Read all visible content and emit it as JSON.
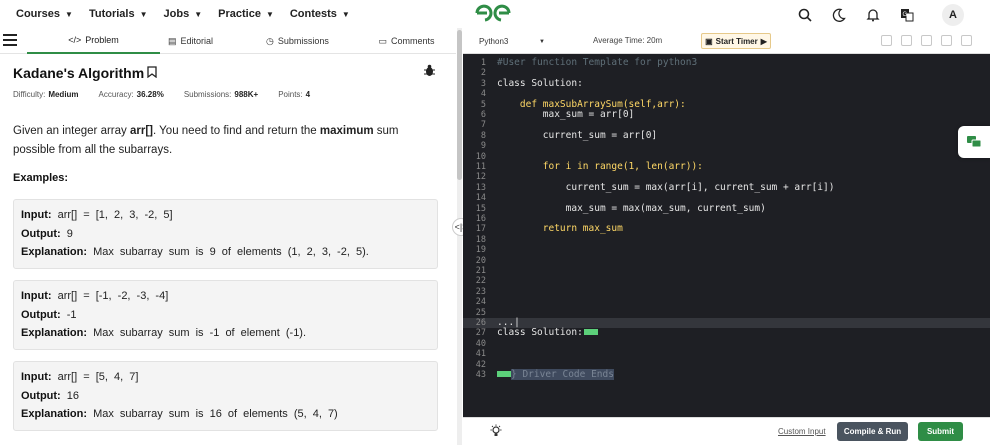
{
  "nav": {
    "items": [
      {
        "label": "Courses"
      },
      {
        "label": "Tutorials"
      },
      {
        "label": "Jobs"
      },
      {
        "label": "Practice"
      },
      {
        "label": "Contests"
      }
    ],
    "avatar_letter": "A",
    "icons": [
      "search-icon",
      "moon-icon",
      "bell-icon",
      "translate-icon"
    ]
  },
  "tabs": [
    {
      "label": "Problem",
      "icon": "code-icon",
      "active": true
    },
    {
      "label": "Editorial",
      "icon": "document-icon",
      "active": false
    },
    {
      "label": "Submissions",
      "icon": "clock-icon",
      "active": false
    },
    {
      "label": "Comments",
      "icon": "comment-icon",
      "active": false
    }
  ],
  "problem": {
    "title": "Kadane's Algorithm",
    "difficulty_label": "Difficulty:",
    "difficulty": "Medium",
    "accuracy_label": "Accuracy:",
    "accuracy": "36.28%",
    "submissions_label": "Submissions:",
    "submissions": "988K+",
    "points_label": "Points:",
    "points": "4",
    "desc_1": "Given an integer array ",
    "desc_arr": "arr[]",
    "desc_2": ". You need to find and return the ",
    "desc_max": "maximum",
    "desc_3": " sum possible from all the subarrays.",
    "examples_title": "Examples:",
    "examples": [
      {
        "input": "arr[] = [1, 2, 3, -2, 5]",
        "output": "9",
        "explanation": "Max subarray sum is 9 of elements (1, 2, 3, -2, 5)."
      },
      {
        "input": "arr[] = [-1, -2, -3, -4]",
        "output": "-1",
        "explanation": "Max subarray sum is -1 of element (-1)."
      },
      {
        "input": "arr[] = [5, 4, 7]",
        "output": "16",
        "explanation": "Max subarray sum is 16 of elements (5, 4, 7)"
      }
    ],
    "input_label": "Input:",
    "output_label": "Output:",
    "explanation_label": "Explanation:"
  },
  "editor": {
    "language": "Python3",
    "avg_time": "Average Time: 20m",
    "timer_label": "Start Timer",
    "custom_input": "Custom Input",
    "run_label": "Compile & Run",
    "submit_label": "Submit",
    "lines": [
      {
        "n": "1",
        "text": "#User function Template for python3"
      },
      {
        "n": "2",
        "text": ""
      },
      {
        "n": "3",
        "text": "class Solution:"
      },
      {
        "n": "4",
        "text": ""
      },
      {
        "n": "5",
        "text": "    def maxSubArraySum(self,arr):"
      },
      {
        "n": "6",
        "text": "        max_sum = arr[0]"
      },
      {
        "n": "7",
        "text": ""
      },
      {
        "n": "8",
        "text": "        current_sum = arr[0]"
      },
      {
        "n": "9",
        "text": ""
      },
      {
        "n": "10",
        "text": ""
      },
      {
        "n": "11",
        "text": "        for i in range(1, len(arr)):"
      },
      {
        "n": "12",
        "text": ""
      },
      {
        "n": "13",
        "text": "            current_sum = max(arr[i], current_sum + arr[i])"
      },
      {
        "n": "14",
        "text": ""
      },
      {
        "n": "15",
        "text": "            max_sum = max(max_sum, current_sum)"
      },
      {
        "n": "16",
        "text": ""
      },
      {
        "n": "17",
        "text": "        return max_sum"
      },
      {
        "n": "18",
        "text": ""
      },
      {
        "n": "19",
        "text": ""
      },
      {
        "n": "20",
        "text": ""
      },
      {
        "n": "21",
        "text": ""
      },
      {
        "n": "22",
        "text": ""
      },
      {
        "n": "23",
        "text": ""
      },
      {
        "n": "24",
        "text": ""
      },
      {
        "n": "25",
        "text": ""
      },
      {
        "n": "26",
        "text": "...|"
      },
      {
        "n": "27",
        "text": "class Solution:"
      },
      {
        "n": "40",
        "text": ""
      },
      {
        "n": "41",
        "text": ""
      },
      {
        "n": "42",
        "text": ""
      },
      {
        "n": "43",
        "text": "} Driver Code Ends"
      }
    ]
  },
  "colors": {
    "brand_green": "#2f8d46",
    "editor_bg": "#1e1f24"
  }
}
